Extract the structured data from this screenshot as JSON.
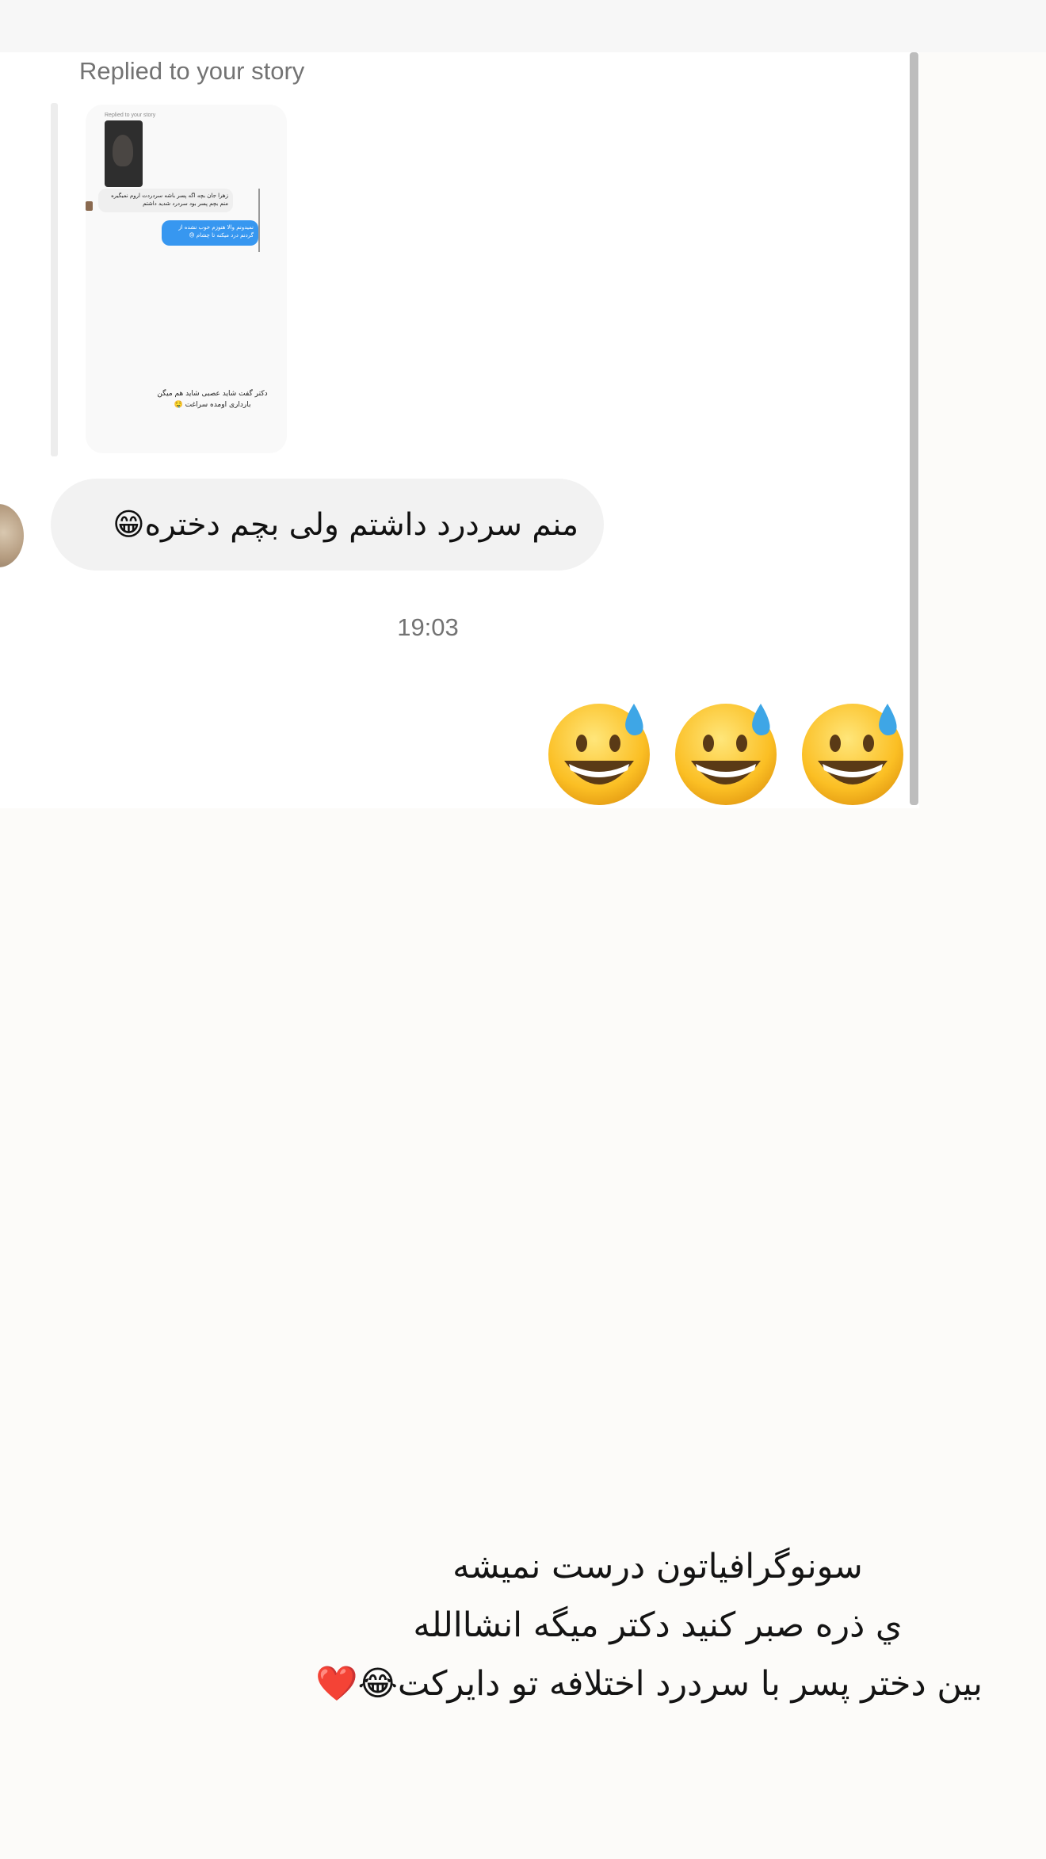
{
  "thread": {
    "replied_label": "Replied to your story",
    "story_preview": {
      "replied_label": "Replied to your story",
      "incoming_message": "زهرا جان بچه اگه پسر باشه سردردت اروم نمیگیره منم بچم پسر بود سردرد شدید داشتم",
      "outgoing_message": "نمیدونم والا هنوزم خوب نشده از گردنم درد میکنه تا چشام 😓",
      "caption": "دکتر گفت شاید عصبی شاید هم میگن بارداری اومده سراغت 🤤"
    },
    "incoming_message": "منم سردرد داشتم ولی بچم دختره😁",
    "timestamp": "19:03",
    "sent_emojis": [
      "😅",
      "😅",
      "😅"
    ]
  },
  "story_caption": {
    "lines": [
      "سونوگرافیاتون درست نمیشه",
      "ي ذره صبر کنید دکتر میگه انشاالله",
      "بین دختر پسر با سردرد اختلافه تو دایرکت😂❤️"
    ]
  },
  "icons": {
    "emoji_face": "grinning-face-with-sweat-icon"
  },
  "colors": {
    "incoming_bubble": "#f2f2f2",
    "outgoing_bubble": "#3797f0",
    "secondary_text": "#737373",
    "scrollbar": "#bdbdbd"
  }
}
